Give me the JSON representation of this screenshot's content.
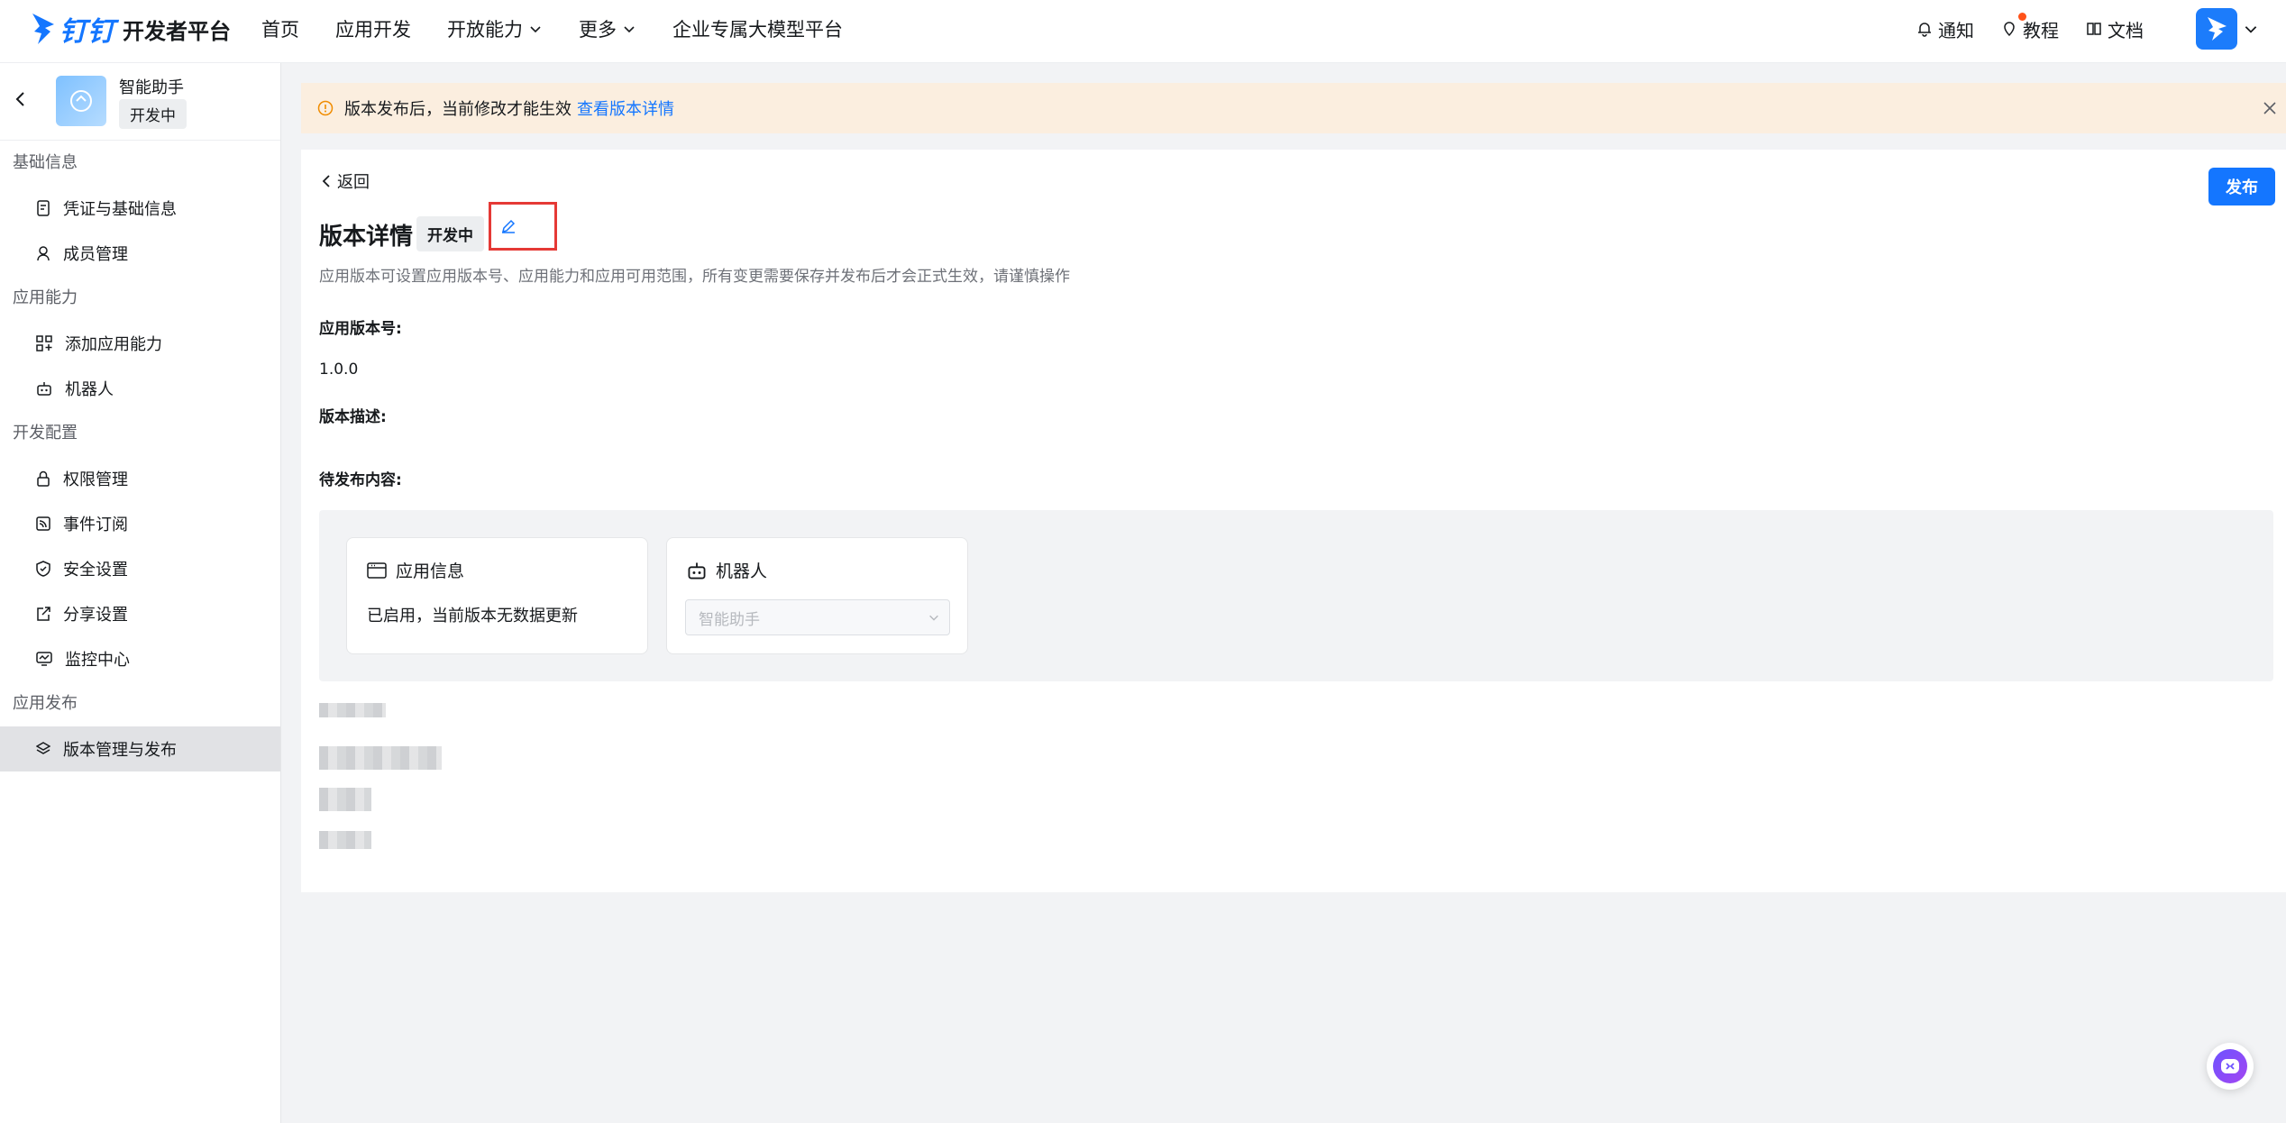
{
  "header": {
    "logo_word": "钉钉",
    "platform_title": "开发者平台",
    "nav": [
      {
        "label": "首页"
      },
      {
        "label": "应用开发"
      },
      {
        "label": "开放能力"
      },
      {
        "label": "更多"
      },
      {
        "label": "企业专属大模型平台"
      }
    ],
    "notify_label": "通知",
    "tutorial_label": "教程",
    "docs_label": "文档"
  },
  "sidebar": {
    "app_name": "智能助手",
    "app_status": "开发中",
    "groups": [
      {
        "title": "基础信息",
        "items": [
          {
            "label": "凭证与基础信息"
          },
          {
            "label": "成员管理"
          }
        ]
      },
      {
        "title": "应用能力",
        "items": [
          {
            "label": "添加应用能力"
          },
          {
            "label": "机器人"
          }
        ]
      },
      {
        "title": "开发配置",
        "items": [
          {
            "label": "权限管理"
          },
          {
            "label": "事件订阅"
          },
          {
            "label": "安全设置"
          },
          {
            "label": "分享设置"
          },
          {
            "label": "监控中心"
          }
        ]
      },
      {
        "title": "应用发布",
        "items": [
          {
            "label": "版本管理与发布"
          }
        ]
      }
    ]
  },
  "notice": {
    "text": "版本发布后，当前修改才能生效",
    "link": "查看版本详情"
  },
  "main": {
    "back_label": "返回",
    "publish_label": "发布",
    "title": "版本详情",
    "status": "开发中",
    "description": "应用版本可设置应用版本号、应用能力和应用可用范围，所有变更需要保存并发布后才会正式生效，请谨慎操作",
    "version_label": "应用版本号:",
    "version_value": "1.0.0",
    "desc_label": "版本描述:",
    "pending_label": "待发布内容:",
    "cards": {
      "app_info_title": "应用信息",
      "app_info_text": "已启用，当前版本无数据更新",
      "robot_title": "机器人",
      "robot_select": "智能助手"
    }
  },
  "colors": {
    "accent": "#1476ff",
    "notice_bg": "#fbeedf",
    "highlight_border": "#e53935"
  }
}
